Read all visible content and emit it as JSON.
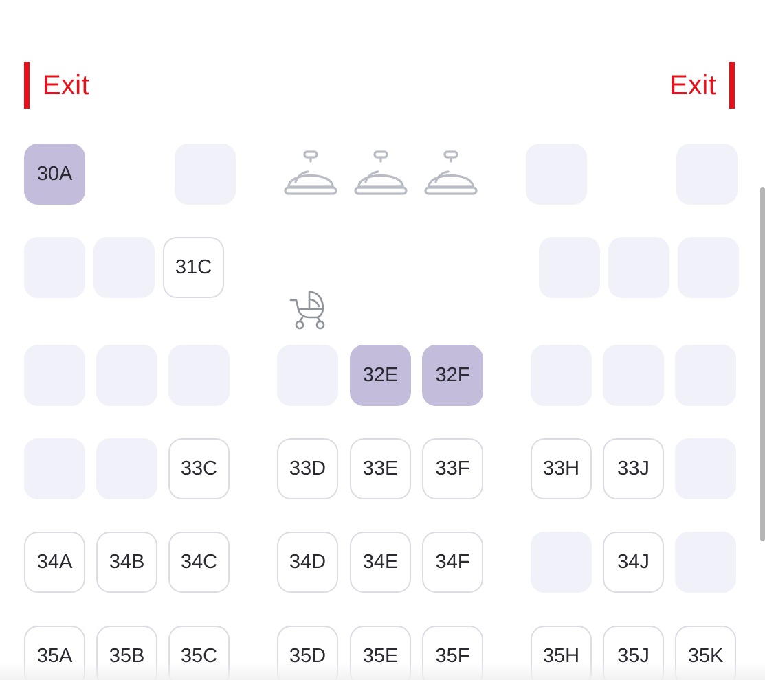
{
  "exits": {
    "left_label": "Exit",
    "right_label": "Exit",
    "accent_color": "#e8101a"
  },
  "colors": {
    "unavailable": "#f0f1f9",
    "available_border": "#dcdce6",
    "selected": "#c4bcdb",
    "text": "#2a2a33"
  },
  "facilities": {
    "galley_icon": "serving-cloche-icon",
    "galley_count": 3,
    "bassinet_icon": "baby-stroller-icon"
  },
  "rows": {
    "r30": {
      "A": "30A",
      "B": "",
      "C": "",
      "H": "",
      "K": ""
    },
    "r31": {
      "A": "",
      "B": "",
      "C": "31C",
      "H": "",
      "J": "",
      "K": ""
    },
    "r32": {
      "A": "",
      "B": "",
      "C": "",
      "D": "",
      "E": "32E",
      "F": "32F",
      "H": "",
      "J": "",
      "K": ""
    },
    "r33": {
      "A": "",
      "B": "",
      "C": "33C",
      "D": "33D",
      "E": "33E",
      "F": "33F",
      "H": "33H",
      "J": "33J",
      "K": ""
    },
    "r34": {
      "A": "34A",
      "B": "34B",
      "C": "34C",
      "D": "34D",
      "E": "34E",
      "F": "34F",
      "H": "",
      "J": "34J",
      "K": ""
    },
    "r35": {
      "A": "35A",
      "B": "35B",
      "C": "35C",
      "D": "35D",
      "E": "35E",
      "F": "35F",
      "H": "35H",
      "J": "35J",
      "K": "35K"
    }
  }
}
